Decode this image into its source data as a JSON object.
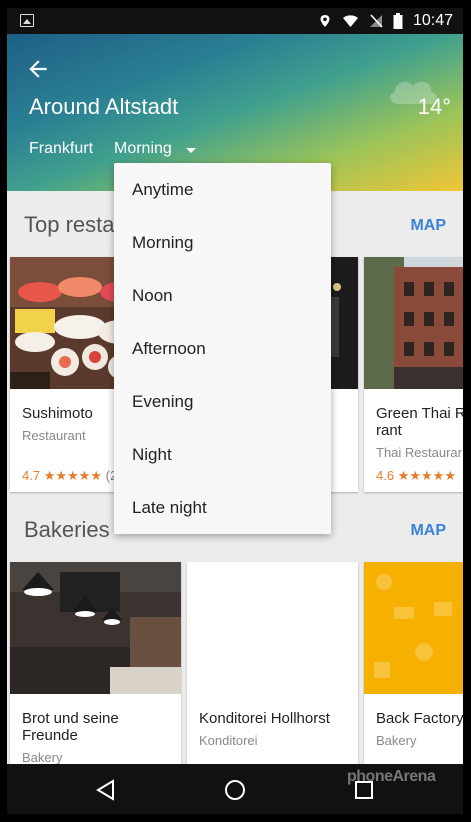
{
  "status_bar": {
    "time": "10:47"
  },
  "header": {
    "title": "Around Altstadt",
    "temperature": "14°",
    "city": "Frankfurt",
    "time_filter": "Morning"
  },
  "dropdown": {
    "options": [
      "Anytime",
      "Morning",
      "Noon",
      "Afternoon",
      "Evening",
      "Night",
      "Late night"
    ]
  },
  "sections": [
    {
      "title": "Top resta",
      "map_label": "MAP",
      "cards": [
        {
          "name": "Sushimoto",
          "type": "Restaurant",
          "rating": "4.7",
          "stars": "★★★★★",
          "count": "(2"
        },
        {
          "name": "",
          "type": "",
          "rating": "",
          "stars": "",
          "count": ""
        },
        {
          "name": "Green Thai R\nrant",
          "type": "Thai Restaurar",
          "rating": "4.6",
          "stars": "★★★★★",
          "count": ""
        }
      ]
    },
    {
      "title": "Bakeries",
      "map_label": "MAP",
      "cards": [
        {
          "name": "Brot und seine\nFreunde",
          "type": "Bakery"
        },
        {
          "name": "Konditorei Hollhorst",
          "type": "Konditorei"
        },
        {
          "name": "Back Factory",
          "type": "Bakery"
        }
      ]
    }
  ],
  "watermark": "phoneArena",
  "colors": {
    "accent": "#3b82d6",
    "rating": "#e47c2b"
  }
}
